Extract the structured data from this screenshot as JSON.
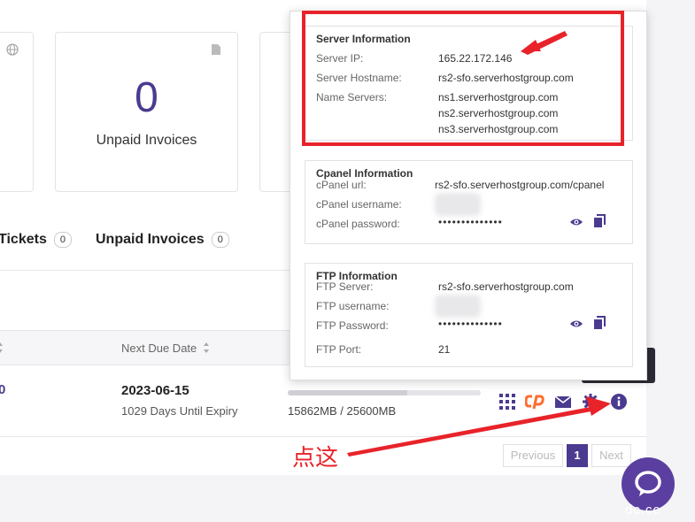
{
  "stats": {
    "unpaid_invoices_count": "0",
    "unpaid_invoices_label": "Unpaid Invoices"
  },
  "tabs": {
    "tickets_label": "Tickets",
    "tickets_count": "0",
    "invoices_label": "Unpaid Invoices",
    "invoices_count": "0"
  },
  "table": {
    "next_due_header": "Next Due Date",
    "row": {
      "left_cut": "0",
      "due_date": "2023-06-15",
      "days_left": "1029 Days Until Expiry",
      "usage_text": "15862MB / 25600MB",
      "usage_fraction": 0.62
    }
  },
  "pagination": {
    "previous": "Previous",
    "current": "1",
    "next": "Next"
  },
  "server_info": {
    "title": "Server Information",
    "ip_label": "Server IP:",
    "ip_value": "165.22.172.146",
    "hostname_label": "Server Hostname:",
    "hostname_value": "rs2-sfo.serverhostgroup.com",
    "ns_label": "Name Servers:",
    "ns1": "ns1.serverhostgroup.com",
    "ns2": "ns2.serverhostgroup.com",
    "ns3": "ns3.serverhostgroup.com"
  },
  "cpanel_info": {
    "title": "Cpanel Information",
    "url_label": "cPanel url:",
    "url_value": "rs2-sfo.serverhostgroup.com/cpanel",
    "username_label": "cPanel username:",
    "password_label": "cPanel password:",
    "password_value": "••••••••••••••"
  },
  "ftp_info": {
    "title": "FTP Information",
    "server_label": "FTP Server:",
    "server_value": "rs2-sfo.serverhostgroup.com",
    "username_label": "FTP username:",
    "password_label": "FTP Password:",
    "password_value": "••••••••••••••",
    "port_label": "FTP Port:",
    "port_value": "21"
  },
  "annotation": {
    "click_here": "点这"
  },
  "watermark": "dc.cc",
  "colors": {
    "accent": "#4b3a8f",
    "annotation_red": "#e8232a",
    "cpanel_orange": "#ff6c2c"
  }
}
